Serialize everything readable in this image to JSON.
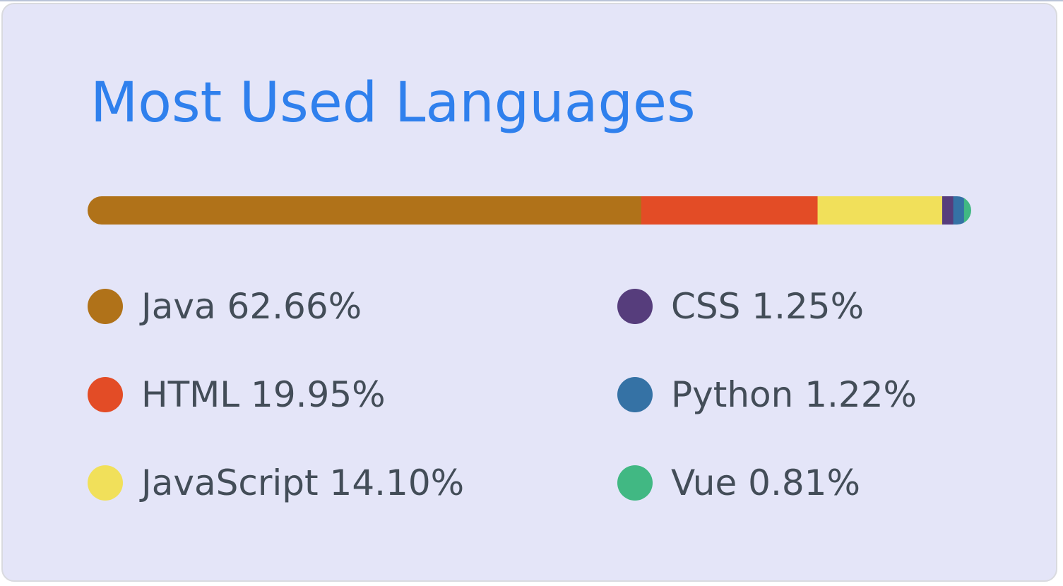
{
  "card": {
    "title": "Most Used Languages"
  },
  "chart_data": {
    "type": "bar",
    "orientation": "horizontal-stacked",
    "title": "Most Used Languages",
    "unit": "%",
    "series": [
      {
        "name": "Java",
        "value": 62.66,
        "label": "62.66%",
        "color": "#b07219"
      },
      {
        "name": "HTML",
        "value": 19.95,
        "label": "19.95%",
        "color": "#e34c26"
      },
      {
        "name": "JavaScript",
        "value": 14.1,
        "label": "14.10%",
        "color": "#f1e05a"
      },
      {
        "name": "CSS",
        "value": 1.25,
        "label": "1.25%",
        "color": "#563d7c"
      },
      {
        "name": "Python",
        "value": 1.22,
        "label": "1.22%",
        "color": "#3572a5"
      },
      {
        "name": "Vue",
        "value": 0.81,
        "label": "0.81%",
        "color": "#41b883"
      }
    ],
    "legend": "bottom, two columns"
  },
  "colors": {
    "title": "#2f80ed",
    "text": "#434d58",
    "background": "#e4e5f8"
  }
}
